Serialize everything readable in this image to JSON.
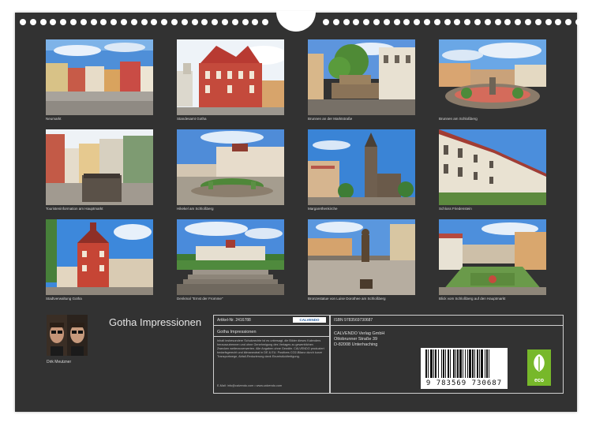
{
  "calendar": {
    "title": "Gotha Impressionen",
    "photographer": "Dirk Meutzner"
  },
  "photos": [
    {
      "caption": "Neumarkt"
    },
    {
      "caption": "Standesamt Gotha"
    },
    {
      "caption": "Brunnen an der Marktstraße"
    },
    {
      "caption": "Brunnen am Schloßberg"
    },
    {
      "caption": "Touristeninformation am Hauptmarkt"
    },
    {
      "caption": "Hikekel am Schloßberg"
    },
    {
      "caption": "Margarethenkirche"
    },
    {
      "caption": "Schloss Friedenstein"
    },
    {
      "caption": "Stadtverwaltung Gotha"
    },
    {
      "caption": "Denkmal \"Ernst der Fromme\""
    },
    {
      "caption": "Bronzestatue von Luise Dorothee am Schloßberg"
    },
    {
      "caption": "Blick vom Schloßberg auf den Hauptmarkt"
    }
  ],
  "info": {
    "artikel": "Artikel-Nr. 2416788",
    "brand": "CALVENDO",
    "title": "Gotha Impressionen",
    "legal_text": "Inhalt insbesondere Schutzrechte ist es untersagt, die Bilder dieses Kalenders herauszutrennen und ohne Genehmigung des Verlages zu gewerblichen Zwecken weiterzuverwerten. Alle Angaben ohne Gewähr. CALVENDO produziert bedarfsgerecht und klimaneutral in DE & EU. Positives CO2-Bilanz durch kurze Transportwege, Abfall-Reduzierung dank Einzelstückfertigung.",
    "email": "E-Mail: info@calvendo.com • www.calvendo.com"
  },
  "isbn": {
    "label": "ISBN 9783569730687",
    "publisher_name": "CALVENDO Verlag GmbH",
    "publisher_street": "Ottobrunner Straße 39",
    "publisher_city": "D-82008 Unterhaching",
    "barcode_number": "9 783569 730687",
    "eco_label": "eco"
  },
  "colors": {
    "background": "#323232",
    "eco_green": "#77b82a"
  }
}
